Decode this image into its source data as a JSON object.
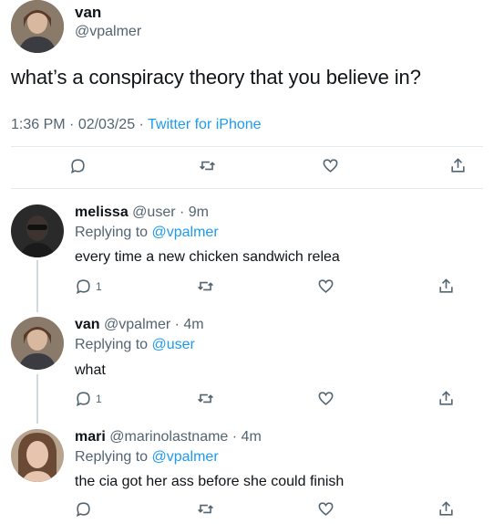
{
  "main_tweet": {
    "author_name": "van",
    "author_handle": "@vpalmer",
    "text": "what’s a conspiracy theory that you believe in?",
    "time": "1:36 PM",
    "date": "02/03/25",
    "source": "Twitter for iPhone",
    "sep1": " · ",
    "sep2": " · "
  },
  "replies": [
    {
      "name": "melissa",
      "handle": "@user",
      "sep": " · ",
      "age": "9m",
      "replying_prefix": "Replying to ",
      "replying_to": "@vpalmer",
      "text": "every time a new chicken sandwich relea",
      "reply_count": "1"
    },
    {
      "name": "van",
      "handle": "@vpalmer",
      "sep": " · ",
      "age": "4m",
      "replying_prefix": "Replying to ",
      "replying_to": "@user",
      "text": "what",
      "reply_count": "1"
    },
    {
      "name": "mari",
      "handle": "@marinolastname",
      "sep": " · ",
      "age": "4m",
      "replying_prefix": "Replying to ",
      "replying_to": "@vpalmer",
      "text": "the cia got her ass before she could finish",
      "reply_count": ""
    }
  ],
  "colors": {
    "text": "#0f1419",
    "muted": "#536471",
    "link": "#1d9bf0",
    "divider": "#e6e9eb"
  },
  "icons": [
    "reply-icon",
    "retweet-icon",
    "like-icon",
    "share-icon"
  ]
}
